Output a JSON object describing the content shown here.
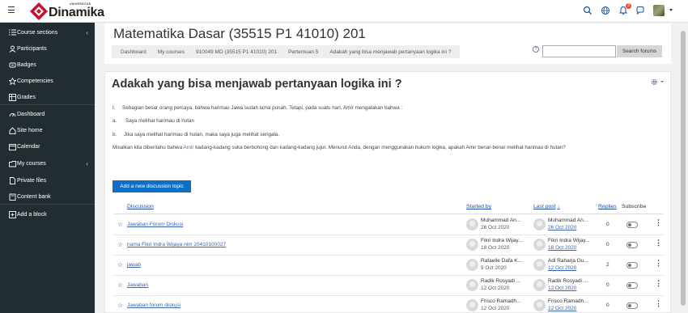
{
  "brand": {
    "univ": "UNIVERSITAS",
    "name": "Dinamika"
  },
  "notifications": {
    "count": "3"
  },
  "sidebar": {
    "items": [
      {
        "label": "Course sections",
        "icon": "list-icon",
        "chevron": "‹"
      },
      {
        "label": "Participants",
        "icon": "users-icon"
      },
      {
        "label": "Badges",
        "icon": "badge-icon"
      },
      {
        "label": "Competencies",
        "icon": "star-icon"
      },
      {
        "label": "Grades",
        "icon": "grades-icon"
      },
      {
        "label": "Dashboard",
        "icon": "dashboard-icon"
      },
      {
        "label": "Site home",
        "icon": "home-icon"
      },
      {
        "label": "Calendar",
        "icon": "calendar-icon"
      },
      {
        "label": "My courses",
        "icon": "courses-icon",
        "chevron": "‹"
      },
      {
        "label": "Private files",
        "icon": "file-icon"
      },
      {
        "label": "Content bank",
        "icon": "content-icon"
      },
      {
        "label": "Add a block",
        "icon": "plus-block-icon"
      }
    ]
  },
  "header": {
    "course_title": "Matematika Dasar (35515 P1 41010) 201",
    "breadcrumb": [
      "Dashboard",
      "My courses",
      "910049 MD (35515 P1 41010) 201",
      "Pertemuan 5",
      "Adakah yang bisa menjawab pertanyaan logika ini ?"
    ],
    "search_placeholder": "",
    "search_button": "Search forums"
  },
  "forum": {
    "title": "Adakah yang bisa menjawab pertanyaan logika ini ?",
    "lines": [
      {
        "num": "I.",
        "text": "Sebagian besar orang percaya, bahwa harimau Jawa sudah lama punah. Tetapi, pada suatu hari, Amir mengatakan bahwa :"
      },
      {
        "num": "a.",
        "text": "Saya melihat harimau di hutan"
      },
      {
        "num": "b.",
        "text": "Jika saya melihat harimau di hutan, maka saya juga melihat serigala."
      }
    ],
    "question_pre": "Misalkan kita diberitahu bahwa ",
    "question_link": "Amir",
    "question_post": " kadang-kadang suka berbohong dan kadang-kadang jujur. Menurut Anda, dengan menggunakan hukum logika, apakah Amir benar-benar melihat harimau di hutan?",
    "add_topic_label": "Add a new discussion topic"
  },
  "table": {
    "headers": {
      "discussion": "Discussion",
      "started_by": "Started by",
      "last_post": "Last post",
      "sort_arrow": "↓",
      "replies": "Replies",
      "subscribe": "Subscribe"
    },
    "rows": [
      {
        "discussion": "Jawaban Forum Diskusi",
        "starter": "Muhammad An...",
        "started": "26 Oct 2020",
        "last_by": "Muhammad An...",
        "last_date": "26 Oct 2020",
        "replies": "0"
      },
      {
        "discussion": "nama Fikri Indra Wijaya nim 20410100027",
        "starter": "Fikri Indra Wijay...",
        "started": "18 Oct 2020",
        "last_by": "Fikri Indra Wijay...",
        "last_date": "18 Oct 2020",
        "replies": "0"
      },
      {
        "discussion": "jawab",
        "starter": "Rafaelle Dafa K...",
        "started": "9 Oct 2020",
        "last_by": "Adi Raharja Gu...",
        "last_date": "12 Oct 2020",
        "replies": "2"
      },
      {
        "discussion": "Jawaban",
        "starter": "Radik Rosyadi ...",
        "started": "12 Oct 2020",
        "last_by": "Radik Rosyadi ...",
        "last_date": "12 Oct 2020",
        "replies": "0"
      },
      {
        "discussion": "Jawaban forum diskusi",
        "starter": "Frisco Ramadh...",
        "started": "12 Oct 2020",
        "last_by": "Frisco Ramadh...",
        "last_date": "12 Oct 2020",
        "replies": "0"
      }
    ]
  },
  "colors": {
    "sidebar_bg": "#222d32",
    "primary": "#0f6fc5",
    "link": "#3a64b5",
    "brand_red": "#c8102e"
  }
}
